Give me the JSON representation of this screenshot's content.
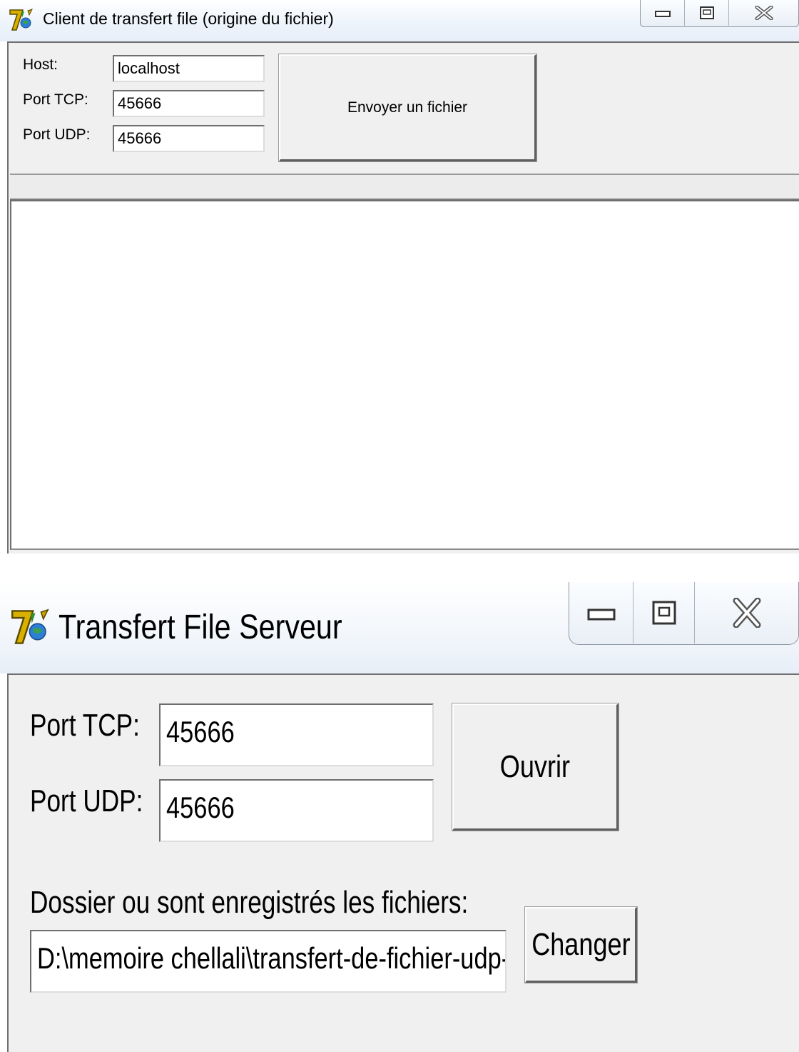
{
  "client_window": {
    "title": "Client de transfert file (origine du fichier)",
    "caption_buttons": [
      "minimize-icon",
      "maximize-icon",
      "close-icon"
    ],
    "host_label": "Host:",
    "host_value": "localhost",
    "tcp_label": "Port TCP:",
    "tcp_value": "45666",
    "udp_label": "Port UDP:",
    "udp_value": "45666",
    "send_button": "Envoyer un fichier"
  },
  "server_window": {
    "title": "Transfert File Serveur",
    "caption_buttons": [
      "minimize-icon",
      "maximize-icon",
      "close-icon"
    ],
    "tcp_label": "Port TCP:",
    "tcp_value": "45666",
    "udp_label": "Port UDP:",
    "udp_value": "45666",
    "open_button": "Ouvrir",
    "folder_label": "Dossier ou sont enregistrés les fichiers:",
    "folder_value": "D:\\memoire chellali\\transfert-de-fichier-udp-",
    "change_button": "Changer"
  }
}
